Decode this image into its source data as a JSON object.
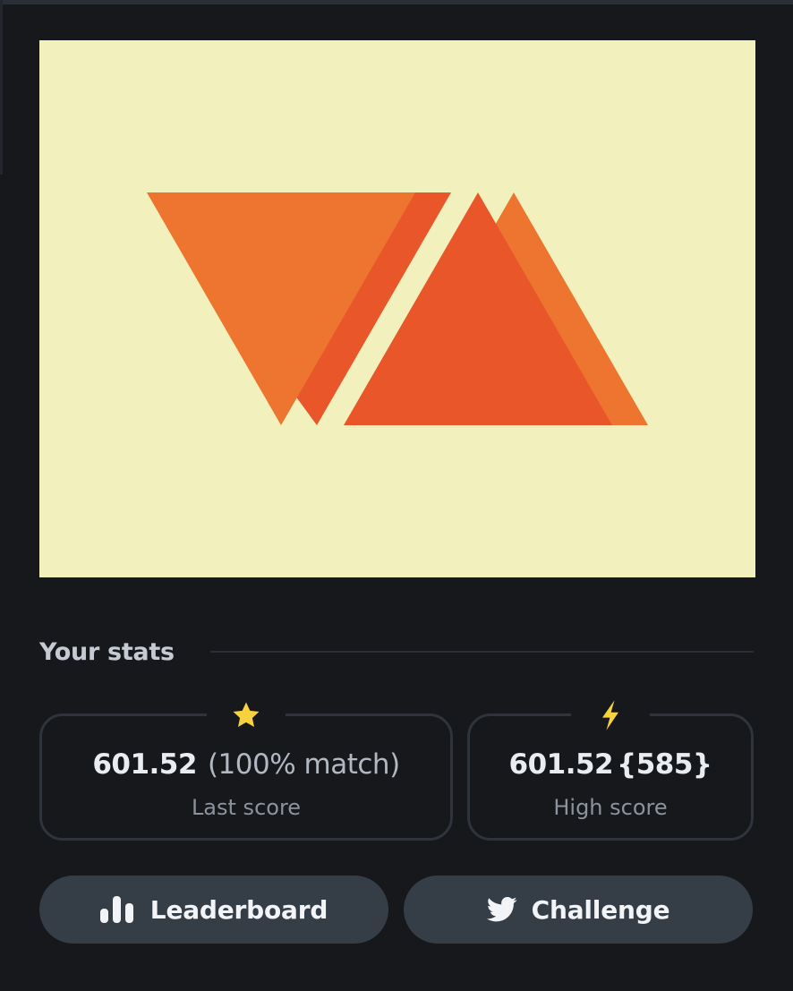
{
  "canvas": {
    "background": "#f2f0bc",
    "shape_colors": [
      "#ee7530",
      "#e9562a"
    ]
  },
  "stats": {
    "title": "Your stats",
    "last": {
      "value": "601.52",
      "match": "(100% match)",
      "label": "Last score",
      "icon": "star-icon",
      "icon_color": "#f7d13e"
    },
    "high": {
      "value": "601.52",
      "extra": "{585}",
      "label": "High score",
      "icon": "lightning-icon",
      "icon_color": "#f7d13e"
    }
  },
  "buttons": {
    "leaderboard": {
      "label": "Leaderboard",
      "icon": "bar-chart-icon"
    },
    "challenge": {
      "label": "Challenge",
      "icon": "twitter-icon"
    }
  }
}
